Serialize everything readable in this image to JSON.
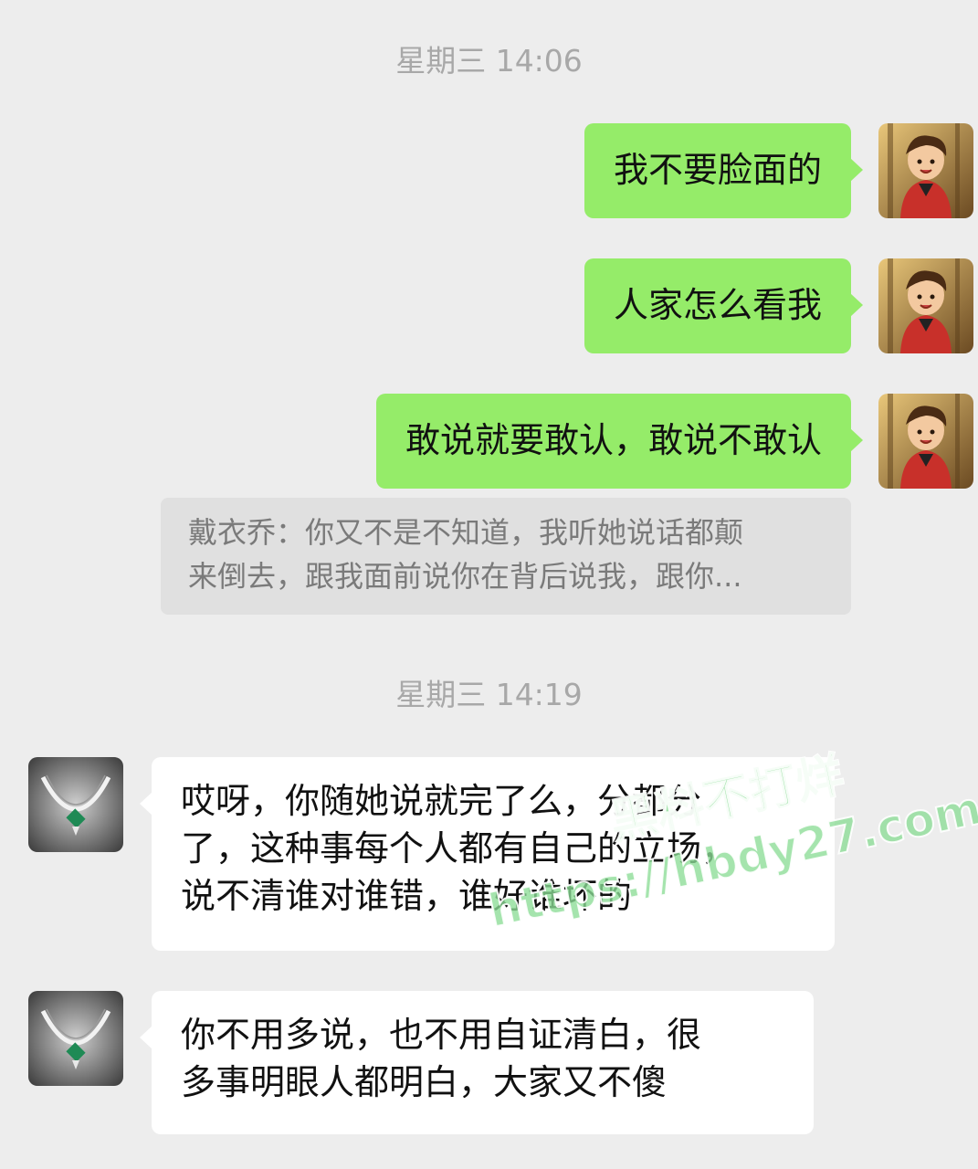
{
  "chat": {
    "timestamps": [
      "星期三 14:06",
      "星期三 14:19"
    ],
    "messages": [
      {
        "side": "out",
        "lines": [
          "我不要脸面的"
        ]
      },
      {
        "side": "out",
        "lines": [
          "人家怎么看我"
        ]
      },
      {
        "side": "out",
        "lines": [
          "敢说就要敢认，敢说不敢认"
        ]
      },
      {
        "side": "in",
        "lines": [
          "哎呀，你随她说就完了么，分都分",
          "了，这种事每个人都有自己的立场，",
          "说不清谁对谁错，谁好谁坏的"
        ]
      },
      {
        "side": "in",
        "lines": [
          "你不用多说，也不用自证清白，很",
          "多事明眼人都明白，大家又不傻"
        ]
      }
    ],
    "quote": {
      "lines": [
        "戴衣乔：你又不是不知道，我听她说话都颠",
        "来倒去，跟我面前说你在背后说我，跟你..."
      ]
    }
  },
  "avatars": {
    "self_icon": "anime-boy-avatar-icon",
    "other_icon": "necklace-avatar-icon"
  },
  "watermark": {
    "line1": "黑料不打烊",
    "line2": "https://hbdy27.com"
  },
  "colors": {
    "background": "#ededed",
    "outgoing_bubble": "#95ec69",
    "incoming_bubble": "#ffffff",
    "timestamp": "#a8a8a8",
    "quote_background": "#e0e0e0",
    "watermark": "#8cdc96"
  }
}
